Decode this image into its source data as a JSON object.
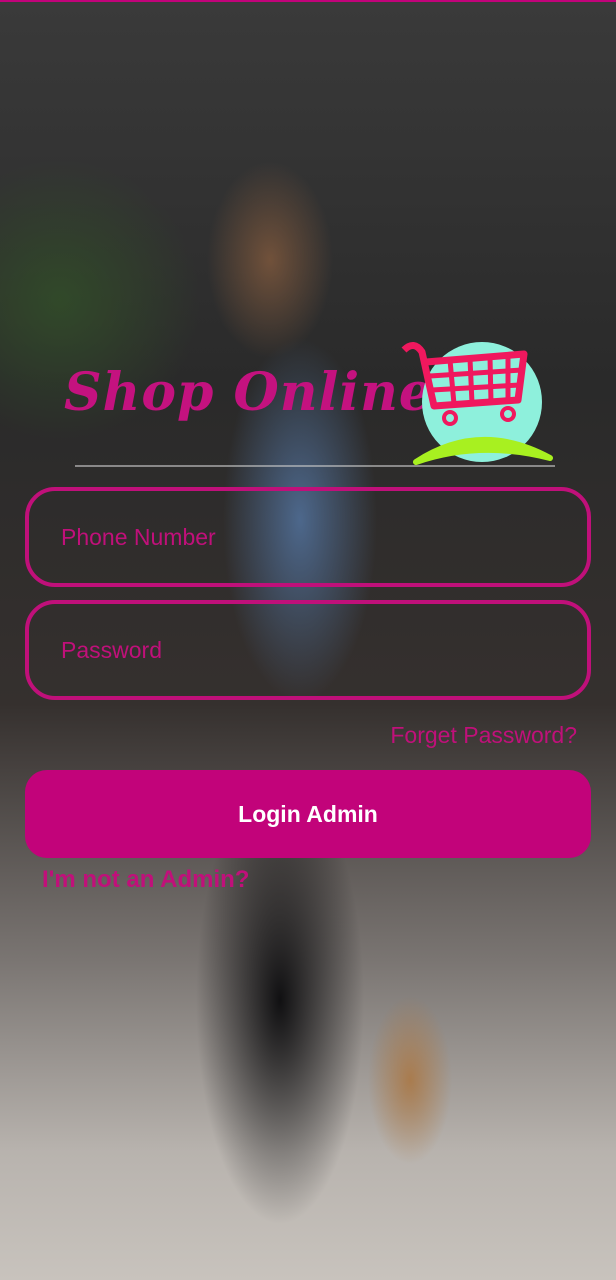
{
  "app": {
    "title": "Shop Online",
    "logo_icon": "shopping-cart-icon"
  },
  "colors": {
    "accent": "#c2037a",
    "logo_circle": "#8ef0dc",
    "cart": "#f0185e",
    "swoosh": "#a8f020"
  },
  "form": {
    "phone_placeholder": "Phone Number",
    "password_placeholder": "Password",
    "forgot_label": "Forget Password?",
    "login_label": "Login Admin",
    "not_admin_label": "I'm not an Admin?"
  }
}
